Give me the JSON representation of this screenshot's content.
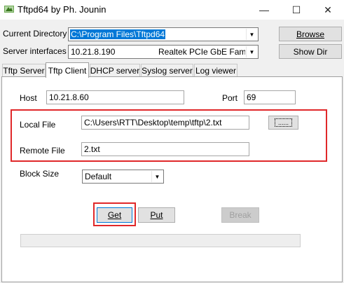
{
  "window": {
    "title": "Tftpd64 by Ph. Jounin",
    "controls": {
      "minimize": "—",
      "maximize": "☐",
      "close": "✕"
    }
  },
  "header": {
    "current_directory_label": "Current Directory",
    "current_directory_value": "C:\\Program Files\\Tftpd64",
    "server_interfaces_label": "Server interfaces",
    "server_ip": "10.21.8.190",
    "server_adapter": "Realtek PCIe GbE Family C",
    "browse_label": "Browse",
    "show_dir_label": "Show Dir"
  },
  "tabs": [
    {
      "label": "Tftp Server"
    },
    {
      "label": "Tftp Client"
    },
    {
      "label": "DHCP server"
    },
    {
      "label": "Syslog server"
    },
    {
      "label": "Log viewer"
    }
  ],
  "active_tab": "Tftp Client",
  "client": {
    "host_label": "Host",
    "host_value": "10.21.8.60",
    "port_label": "Port",
    "port_value": "69",
    "local_file_label": "Local File",
    "local_file_value": "C:\\Users\\RTT\\Desktop\\temp\\tftp\\2.txt",
    "browse_file_label": "......",
    "remote_file_label": "Remote File",
    "remote_file_value": "2.txt",
    "block_size_label": "Block Size",
    "block_size_value": "Default",
    "get_label": "Get",
    "put_label": "Put",
    "break_label": "Break",
    "progress": 0
  },
  "colors": {
    "highlight_red": "#e0282a",
    "selection_blue": "#0078d7",
    "disabled_text": "#a0a0a0"
  }
}
